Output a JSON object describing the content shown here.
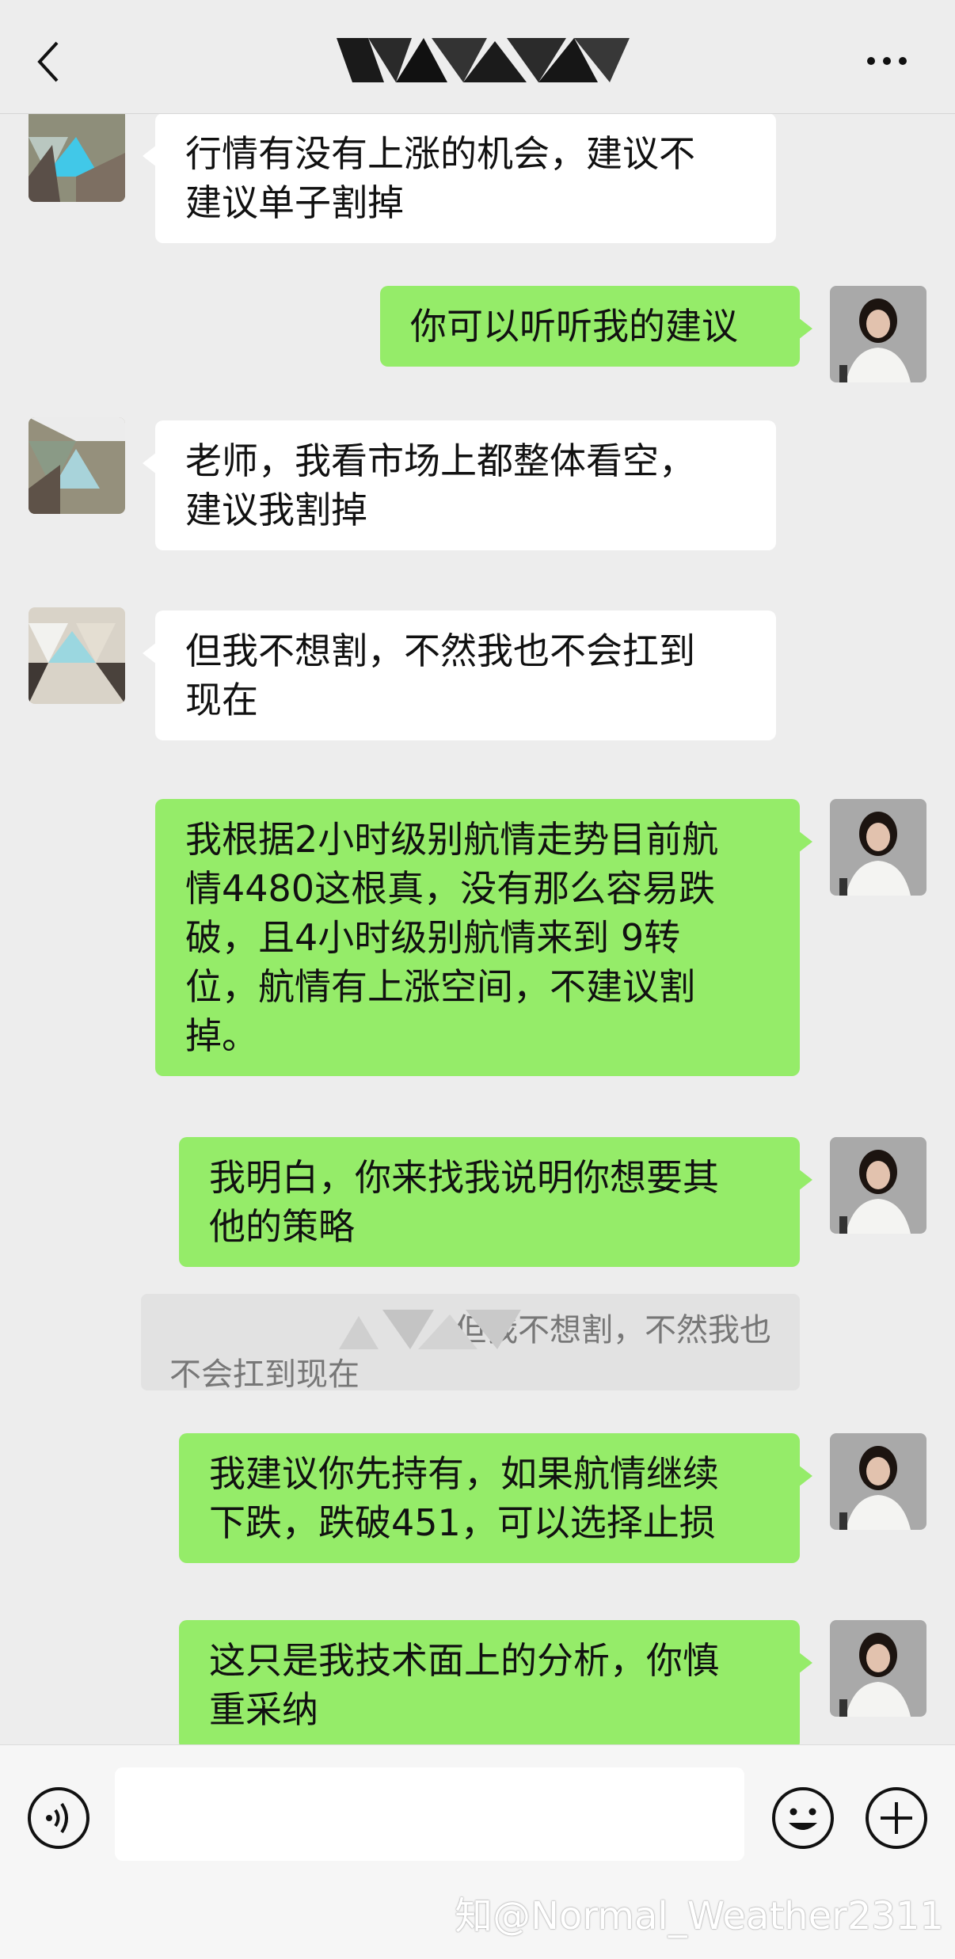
{
  "header": {
    "back_icon": "chevron-left-icon",
    "title": "",
    "more_icon": "more-dots-icon"
  },
  "colors": {
    "background": "#ededed",
    "incoming_bubble": "#ffffff",
    "outgoing_bubble": "#95ec69",
    "quote_bg": "#e2e2e2"
  },
  "messages": [
    {
      "sender": "other",
      "text": "行情有没有上涨的机会，建议不\n建议单子割掉"
    },
    {
      "sender": "me",
      "text": "你可以听听我的建议"
    },
    {
      "sender": "other",
      "text": "老师，我看市场上都整体看空，\n建议我割掉"
    },
    {
      "sender": "other",
      "text": "但我不想割，不然我也不会扛到\n现在"
    },
    {
      "sender": "me",
      "text": "我根据2小时级别航情走势目前航\n情4480这根真，没有那么容易跌\n破，且4小时级别航情来到 9转\n位，航情有上涨空间，不建议割\n掉。"
    },
    {
      "sender": "me",
      "text": "我明白，你来找我说明你想要其\n他的策略",
      "quote": {
        "line1": "但我不想割，不然我也",
        "line2": "不会扛到现在"
      }
    },
    {
      "sender": "me",
      "text": "我建议你先持有，如果航情继续\n下跌，跌破451，可以选择止损"
    },
    {
      "sender": "me",
      "text": "这只是我技术面上的分析，你慎\n重采纳"
    }
  ],
  "input_bar": {
    "voice_icon": "voice-icon",
    "placeholder": "",
    "emoji_icon": "emoji-icon",
    "plus_icon": "plus-icon"
  },
  "watermark": "知@Normal_Weather2311"
}
